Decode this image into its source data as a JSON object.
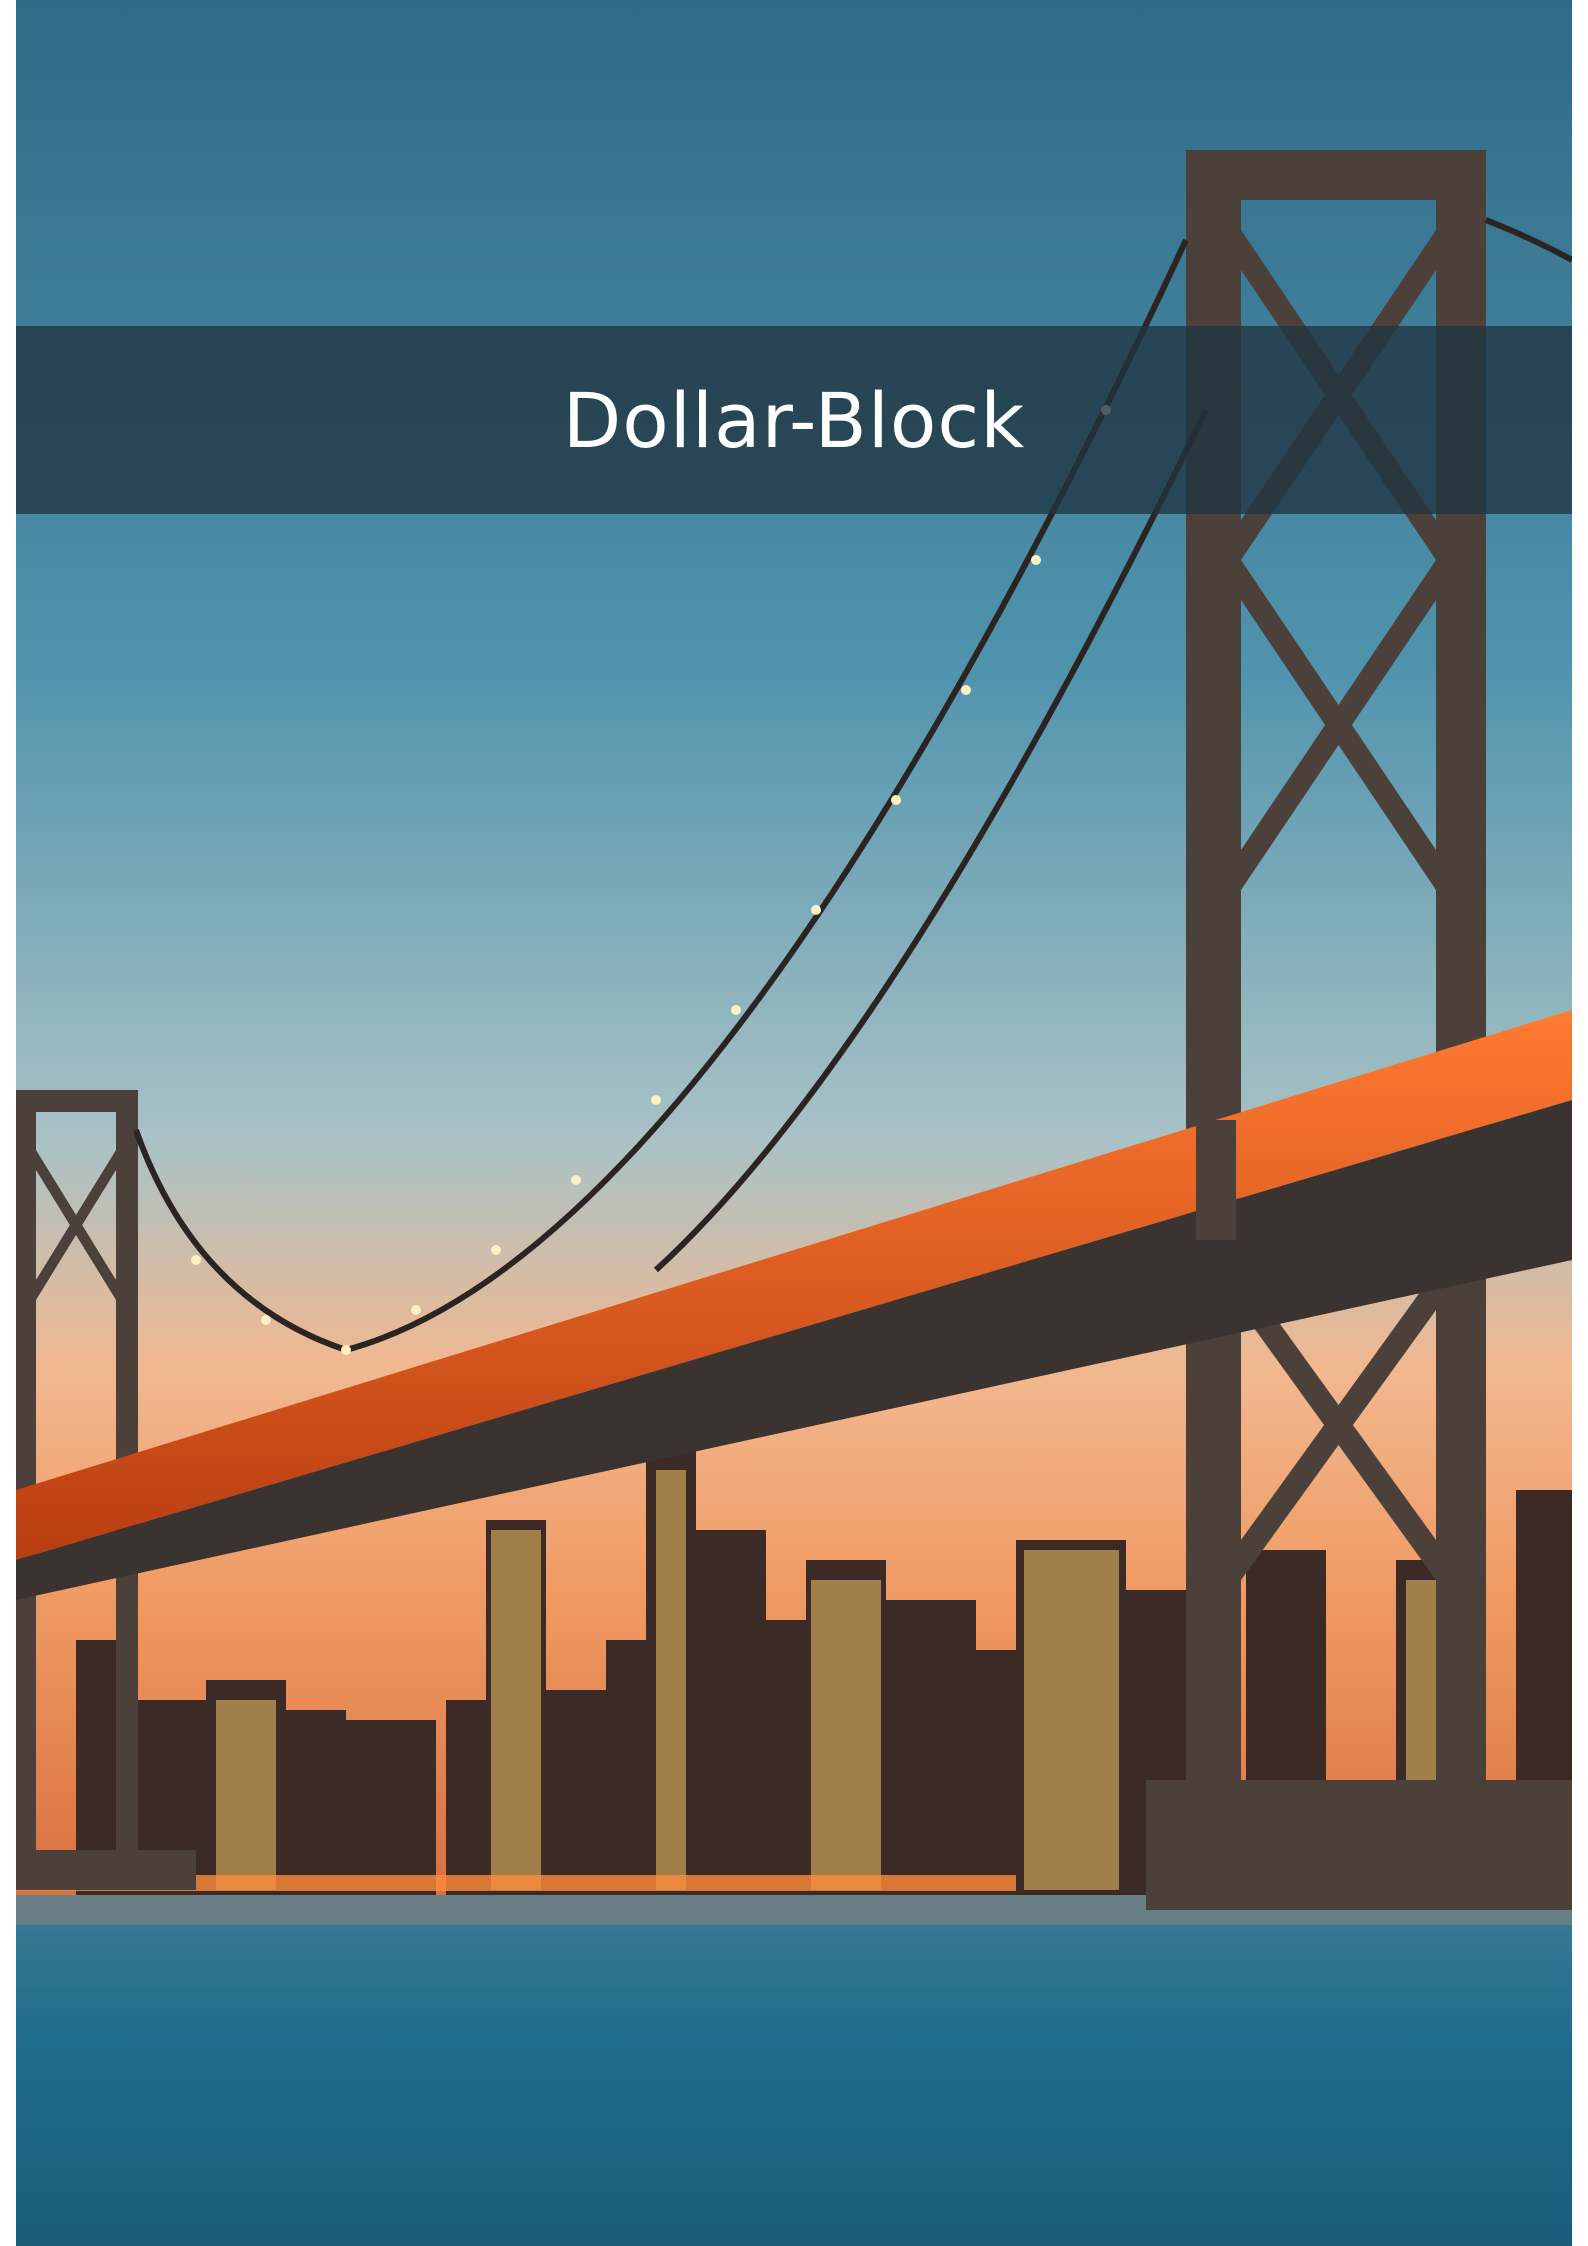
{
  "cover": {
    "title": "Dollar-Block"
  },
  "colors": {
    "band": "#203440",
    "sky_top": "#2f6a86",
    "sky_horizon": "#f4a877",
    "water": "#1c6e8e",
    "bridge_steel": "#4a4a4a",
    "bridge_lights": "#ff6a2a"
  }
}
